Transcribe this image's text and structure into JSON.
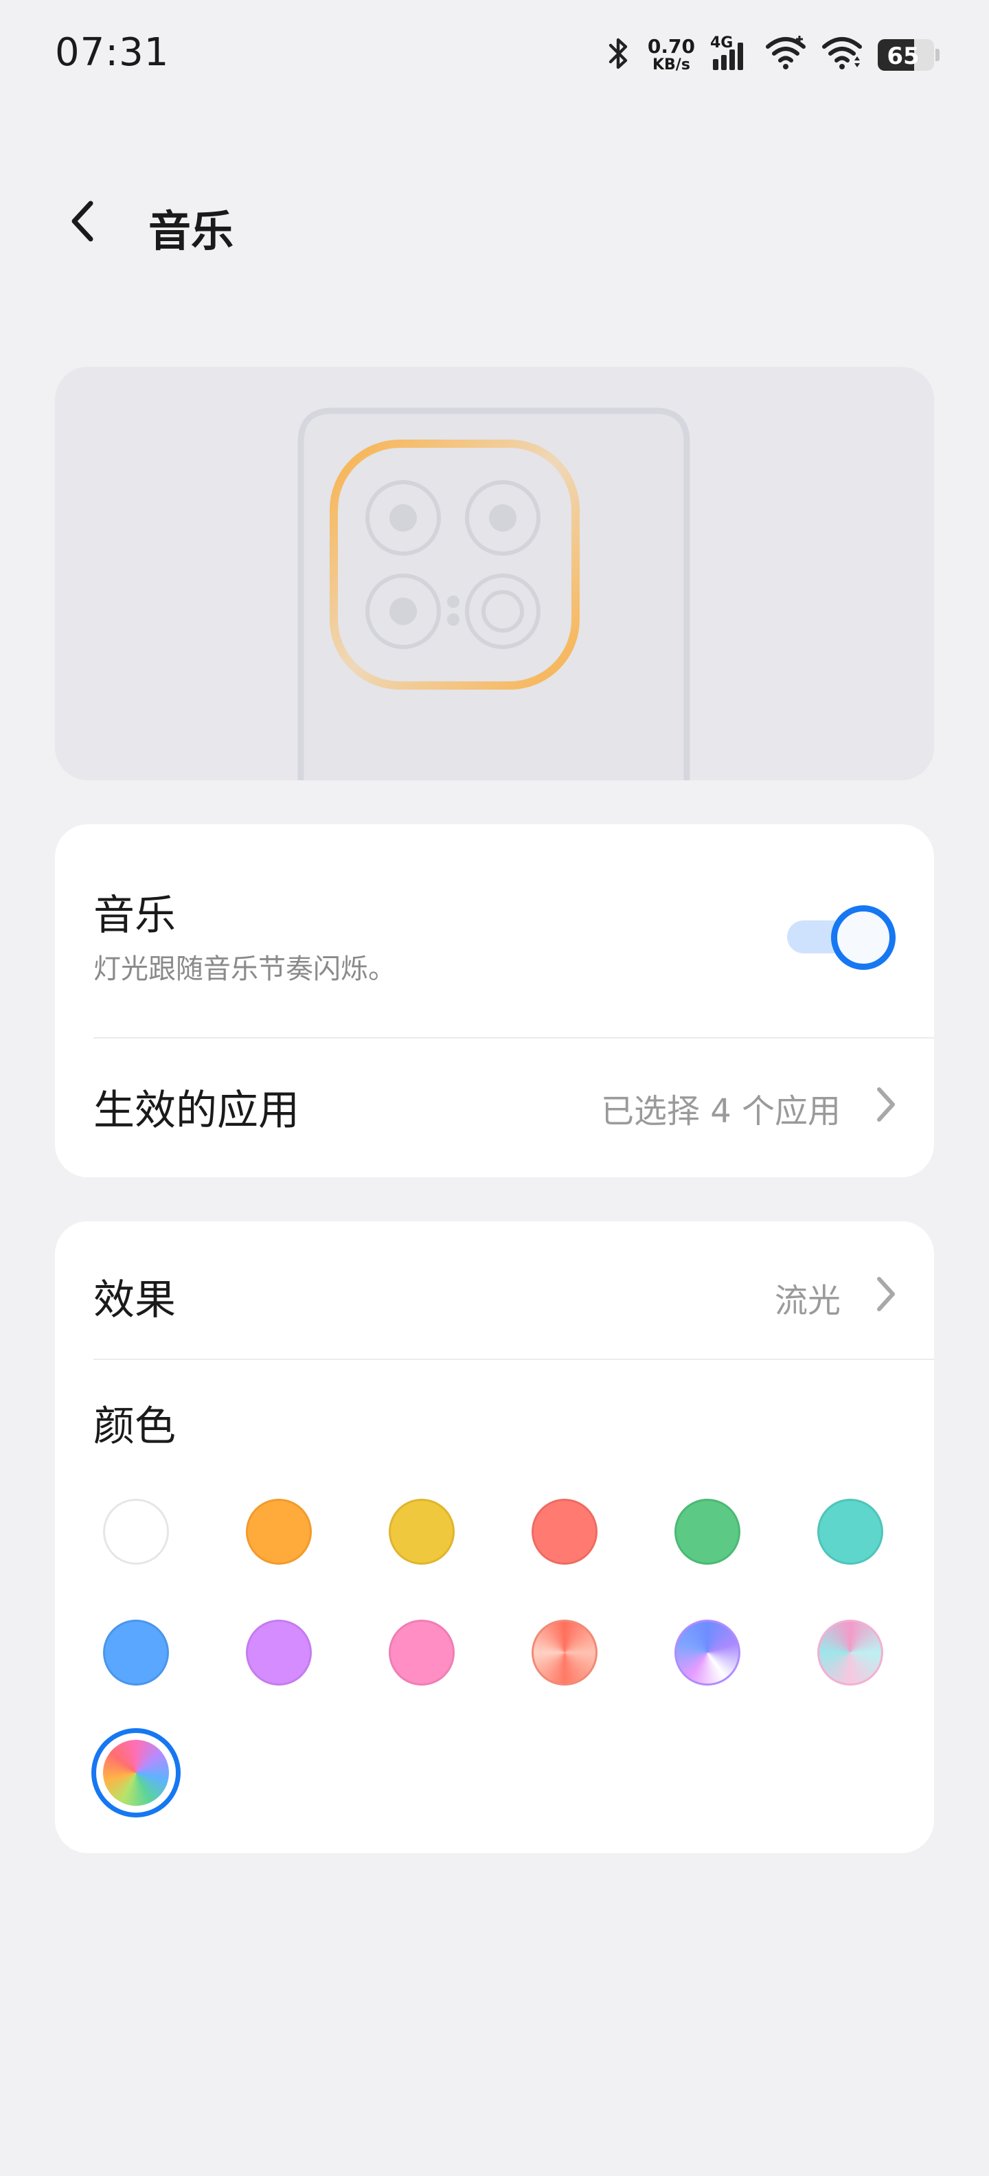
{
  "status": {
    "time": "07:31",
    "net_speed_value": "0.70",
    "net_speed_unit": "KB/s",
    "network_type": "4G",
    "battery": "65",
    "battery_level": 0.65
  },
  "header": {
    "title": "音乐"
  },
  "music_card": {
    "title": "音乐",
    "subtitle": "灯光跟随音乐节奏闪烁。",
    "toggle_on": true,
    "apps_label": "生效的应用",
    "apps_value": "已选择 4 个应用"
  },
  "effect_card": {
    "effect_label": "效果",
    "effect_value": "流光",
    "color_label": "颜色",
    "colors": [
      {
        "name": "white",
        "color": "#ffffff"
      },
      {
        "name": "orange",
        "color": "#ffab3c"
      },
      {
        "name": "yellow",
        "color": "#f0c83e"
      },
      {
        "name": "red",
        "color": "#ff7b72"
      },
      {
        "name": "green",
        "color": "#5cc985"
      },
      {
        "name": "teal",
        "color": "#5fd6cb"
      },
      {
        "name": "blue",
        "color": "#5aa7ff"
      },
      {
        "name": "purple",
        "color": "#d58cff"
      },
      {
        "name": "pink",
        "color": "#ff8ec4"
      },
      {
        "name": "coral-gradient",
        "color": "#ff9a82"
      },
      {
        "name": "blue-purple-gradient",
        "color": "#9b8cff"
      },
      {
        "name": "pink-cyan-gradient",
        "color": "#f3a9cf"
      },
      {
        "name": "rainbow-gradient",
        "color": "#ff7fa1"
      }
    ],
    "selected_color": "rainbow-gradient"
  },
  "colors": {
    "accent": "#1677f2",
    "background": "#f1f1f3",
    "card": "#ffffff"
  }
}
